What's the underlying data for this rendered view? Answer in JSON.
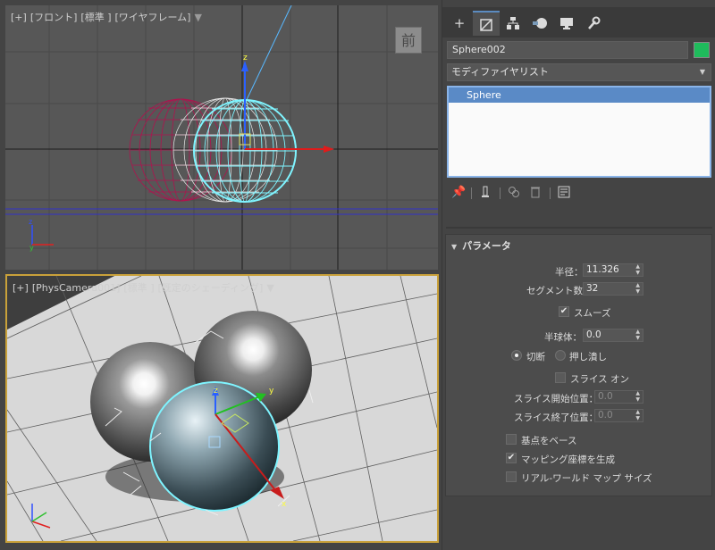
{
  "viewports": {
    "front": {
      "label_plus": "[+]",
      "label_view": "[フロント]",
      "label_mode": "[標準 ]",
      "label_shading": "[ワイヤフレーム]",
      "viewcube_label": "前"
    },
    "perspective": {
      "label_plus": "[+]",
      "label_view": "[PhysCamera001]",
      "label_mode": "[標準 ]",
      "label_shading": "[既定のシェーディング]"
    },
    "gizmo_z": "z",
    "gizmo_y": "y",
    "gizmo_x": "x"
  },
  "command_panel": {
    "tabs": [
      {
        "icon": "create-plus-icon"
      },
      {
        "icon": "modify-icon"
      },
      {
        "icon": "hierarchy-icon"
      },
      {
        "icon": "motion-icon"
      },
      {
        "icon": "display-icon"
      },
      {
        "icon": "utilities-wrench-icon"
      }
    ],
    "object_name": "Sphere002",
    "object_color": "#1fbc5c",
    "modifier_list": "モディファイヤリスト",
    "stack_items": [
      "Sphere"
    ]
  },
  "parameters": {
    "title": "パラメータ",
    "radius_label": "半径：",
    "radius_value": "11.326",
    "segments_label": "セグメント数：",
    "segments_value": "32",
    "smooth_label": "スムーズ",
    "smooth_checked": true,
    "hemisphere_label": "半球体：",
    "hemisphere_value": "0.0",
    "chop_label": "切断",
    "squash_label": "押し潰し",
    "slice_on_label": "スライス オン",
    "slice_from_label": "スライス開始位置：",
    "slice_from_value": "0.0",
    "slice_to_label": "スライス終了位置：",
    "slice_to_value": "0.0",
    "base_to_pivot_label": "基点をベース",
    "gen_mapping_label": "マッピング座標を生成",
    "gen_mapping_checked": true,
    "real_world_label": "リアル-ワールド マップ サイズ"
  },
  "colors": {
    "accent_blue": "#5a8ac6",
    "viewport_active_border": "#c9a13a",
    "selected_wire": "#7ff4ff",
    "magenta_wire": "#b0124e"
  }
}
